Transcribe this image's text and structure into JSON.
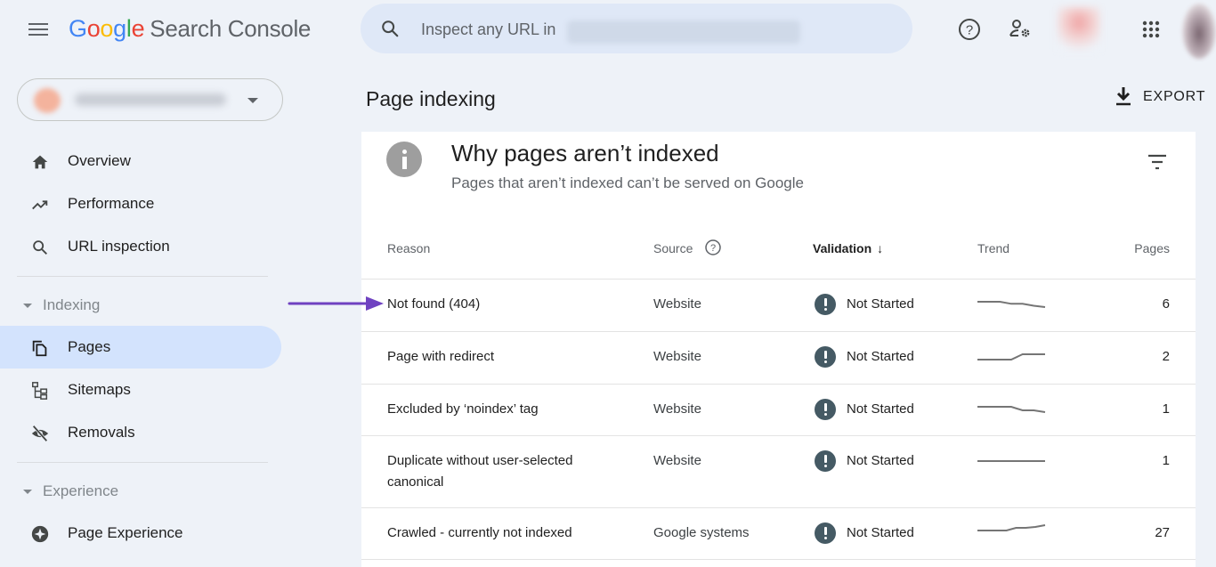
{
  "header": {
    "logo_letters": [
      "G",
      "o",
      "o",
      "g",
      "l",
      "e"
    ],
    "product_name": "Search Console",
    "search_placeholder": "Inspect any URL in",
    "icons": [
      "menu-icon",
      "search-icon",
      "help-icon",
      "user-settings-icon",
      "apps-grid-icon"
    ]
  },
  "sidebar": {
    "property_selector": {
      "icon": "caret-down-icon"
    },
    "top_items": [
      {
        "label": "Overview",
        "icon": "home-icon"
      },
      {
        "label": "Performance",
        "icon": "trending-up-icon"
      },
      {
        "label": "URL inspection",
        "icon": "search-icon"
      }
    ],
    "sections": [
      {
        "label": "Indexing",
        "items": [
          {
            "label": "Pages",
            "icon": "pages-copy-icon",
            "active": true
          },
          {
            "label": "Sitemaps",
            "icon": "sitemap-icon",
            "active": false
          },
          {
            "label": "Removals",
            "icon": "visibility-off-icon",
            "active": false
          }
        ]
      },
      {
        "label": "Experience",
        "items": [
          {
            "label": "Page Experience",
            "icon": "page-experience-icon",
            "active": false
          }
        ]
      }
    ]
  },
  "main": {
    "page_title": "Page indexing",
    "export_label": "EXPORT",
    "card": {
      "title": "Why pages aren’t indexed",
      "subtitle": "Pages that aren’t indexed can’t be served on Google",
      "columns": {
        "reason": "Reason",
        "source": "Source",
        "validation": "Validation",
        "validation_sort": "↓",
        "trend": "Trend",
        "pages": "Pages"
      },
      "rows": [
        {
          "reason": "Not found (404)",
          "source": "Website",
          "validation": "Not Started",
          "pages": "6",
          "trend": [
            6,
            6,
            6,
            5.7,
            5.7,
            5.4,
            5.2
          ]
        },
        {
          "reason": "Page with redirect",
          "source": "Website",
          "validation": "Not Started",
          "pages": "2",
          "trend": [
            1.9,
            1.9,
            1.9,
            1.9,
            2,
            2,
            2
          ]
        },
        {
          "reason": "Excluded by ‘noindex’ tag",
          "source": "Website",
          "validation": "Not Started",
          "pages": "1",
          "trend": [
            1.3,
            1.3,
            1.3,
            1.3,
            1.1,
            1.1,
            1.0
          ]
        },
        {
          "reason": "Duplicate without user-selected canonical",
          "source": "Website",
          "validation": "Not Started",
          "pages": "1",
          "trend": [
            1,
            1,
            1,
            1,
            1,
            1,
            1
          ]
        },
        {
          "reason": "Crawled - currently not indexed",
          "source": "Google systems",
          "validation": "Not Started",
          "pages": "27",
          "trend": [
            24,
            24,
            24,
            24,
            25.5,
            25.5,
            26,
            27
          ]
        }
      ]
    },
    "annotation": {
      "arrow_color": "#6f42c1",
      "points_to": "Not found (404)"
    }
  }
}
